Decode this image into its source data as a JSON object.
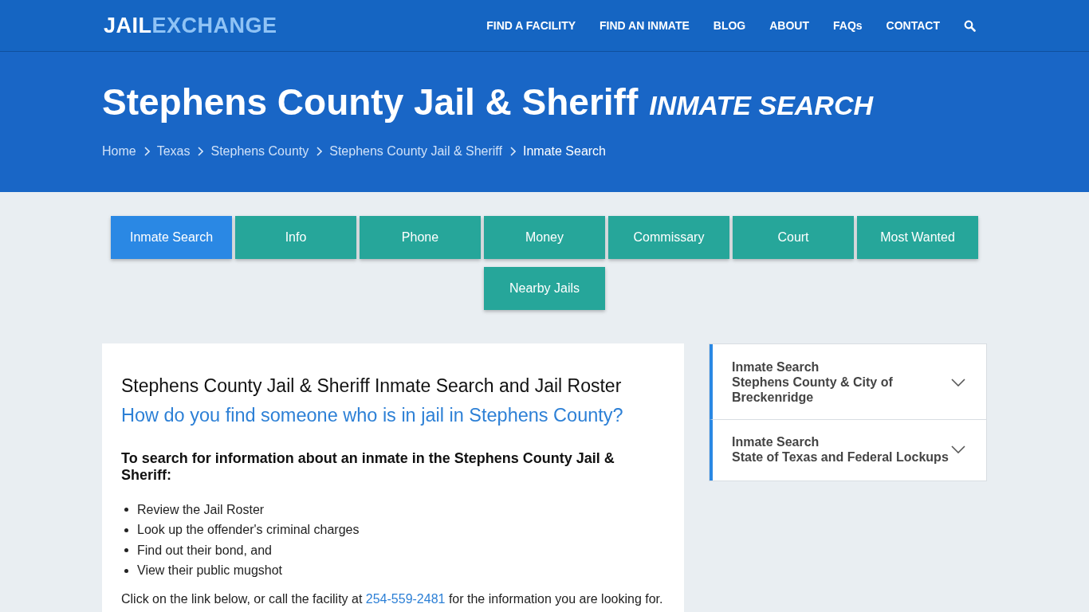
{
  "header": {
    "logo": {
      "part_1": "JAIL",
      "part_2": "EXCHANGE"
    },
    "nav": [
      {
        "label": "FIND A FACILITY"
      },
      {
        "label": "FIND AN INMATE"
      },
      {
        "label": "BLOG"
      },
      {
        "label": "ABOUT"
      },
      {
        "label": "FAQs"
      },
      {
        "label": "CONTACT"
      }
    ]
  },
  "hero": {
    "title": "Stephens County Jail & Sheriff",
    "subtitle": "INMATE SEARCH",
    "breadcrumbs": [
      {
        "label": "Home",
        "current": false
      },
      {
        "label": "Texas",
        "current": false
      },
      {
        "label": "Stephens County",
        "current": false
      },
      {
        "label": "Stephens County Jail & Sheriff",
        "current": false
      },
      {
        "label": "Inmate Search",
        "current": true
      }
    ]
  },
  "tabs": [
    {
      "label": "Inmate Search",
      "selected": true
    },
    {
      "label": "Info",
      "selected": false
    },
    {
      "label": "Phone",
      "selected": false
    },
    {
      "label": "Money",
      "selected": false
    },
    {
      "label": "Commissary",
      "selected": false
    },
    {
      "label": "Court",
      "selected": false
    },
    {
      "label": "Most Wanted",
      "selected": false
    },
    {
      "label": "Nearby Jails",
      "selected": false
    }
  ],
  "article": {
    "heading": "Stephens County Jail & Sheriff Inmate Search and Jail Roster",
    "question": "How do you find someone who is in jail in Stephens County?",
    "subheading": "To search for information about an inmate in the Stephens County Jail & Sheriff:",
    "bullets": [
      "Review the Jail Roster",
      "Look up the offender's criminal charges",
      "Find out their bond, and",
      "View their public mugshot"
    ],
    "call_text": {
      "before": "Click on the link below, or call the facility at ",
      "phone": "254-559-2481",
      "after": " for the information you are looking for."
    }
  },
  "sidebar": {
    "items": [
      {
        "title": "Inmate Search",
        "lines": [
          "Stephens County & City of",
          "Breckenridge"
        ],
        "expanded": false
      },
      {
        "title": "Inmate Search",
        "lines": [
          "State of Texas and Federal Lockups"
        ],
        "expanded": false
      }
    ]
  }
}
